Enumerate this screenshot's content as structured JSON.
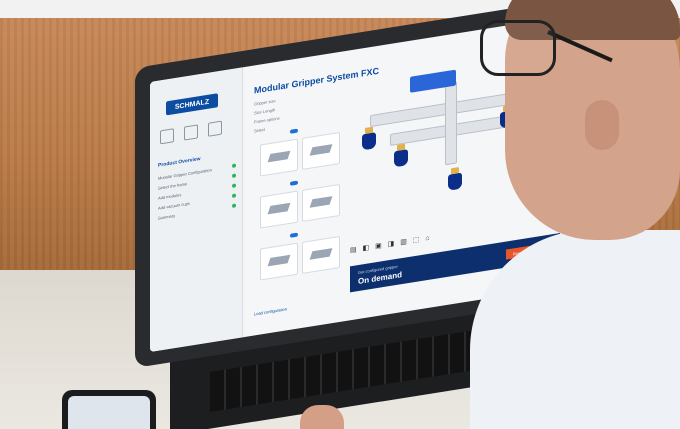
{
  "screen": {
    "logo_text": "SCHMALZ",
    "app_title": "Modular Gripper System FXC",
    "sidebar_title": "Product Overview",
    "sidebar_items": [
      {
        "label": "Modular Gripper Configuration"
      },
      {
        "label": "Select the frame"
      },
      {
        "label": "Add modules"
      },
      {
        "label": "Add vacuum cups"
      },
      {
        "label": "Summary"
      }
    ],
    "options": [
      {
        "label": "Gripper size"
      },
      {
        "label": "Size Length"
      },
      {
        "label": "Frame options"
      },
      {
        "label": "Select"
      }
    ],
    "toolbar_glyphs": "▤ ◧ ▣ ◨ ▥ ⬚ ⌂",
    "banner": {
      "small_text": "Get configured gripper",
      "big_text": "On demand",
      "button_label": "Request quotation"
    },
    "bottom_link": "Load configuration"
  }
}
